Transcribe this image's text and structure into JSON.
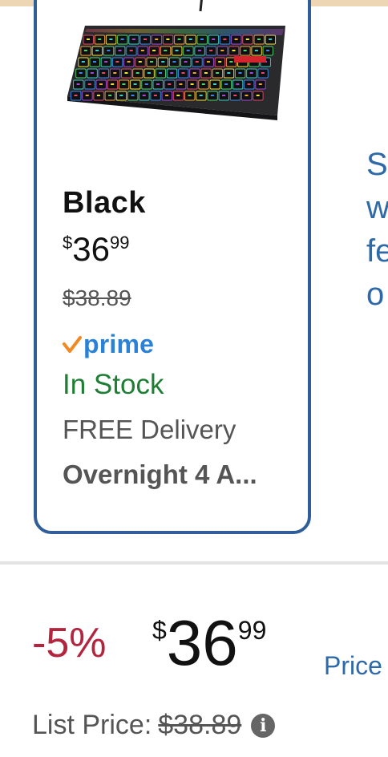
{
  "variant": {
    "name": "Black",
    "price": {
      "symbol": "$",
      "whole": "36",
      "fraction": "99"
    },
    "list_price": "$38.89",
    "prime_label": "prime",
    "stock": "In Stock",
    "delivery": "FREE Delivery",
    "delivery_speed": "Overnight 4 A..."
  },
  "side_link": {
    "text": "S\nw\nfe\no"
  },
  "buybox": {
    "discount": "-5%",
    "price": {
      "symbol": "$",
      "whole": "36",
      "fraction": "99"
    },
    "price_link": "Price",
    "list_price_label": "List Price:",
    "list_price_value": "$38.89"
  },
  "colors": {
    "card_border": "#2f5e98",
    "prime_blue": "#2a82d8",
    "prime_check": "#f08a24",
    "in_stock_green": "#1e7e34",
    "discount_red": "#b3243f",
    "link_blue": "#2f6aa8"
  },
  "icons": {
    "product_image": "rgb-mechanical-keyboard",
    "prime_check": "check-icon",
    "info": "info-icon"
  }
}
